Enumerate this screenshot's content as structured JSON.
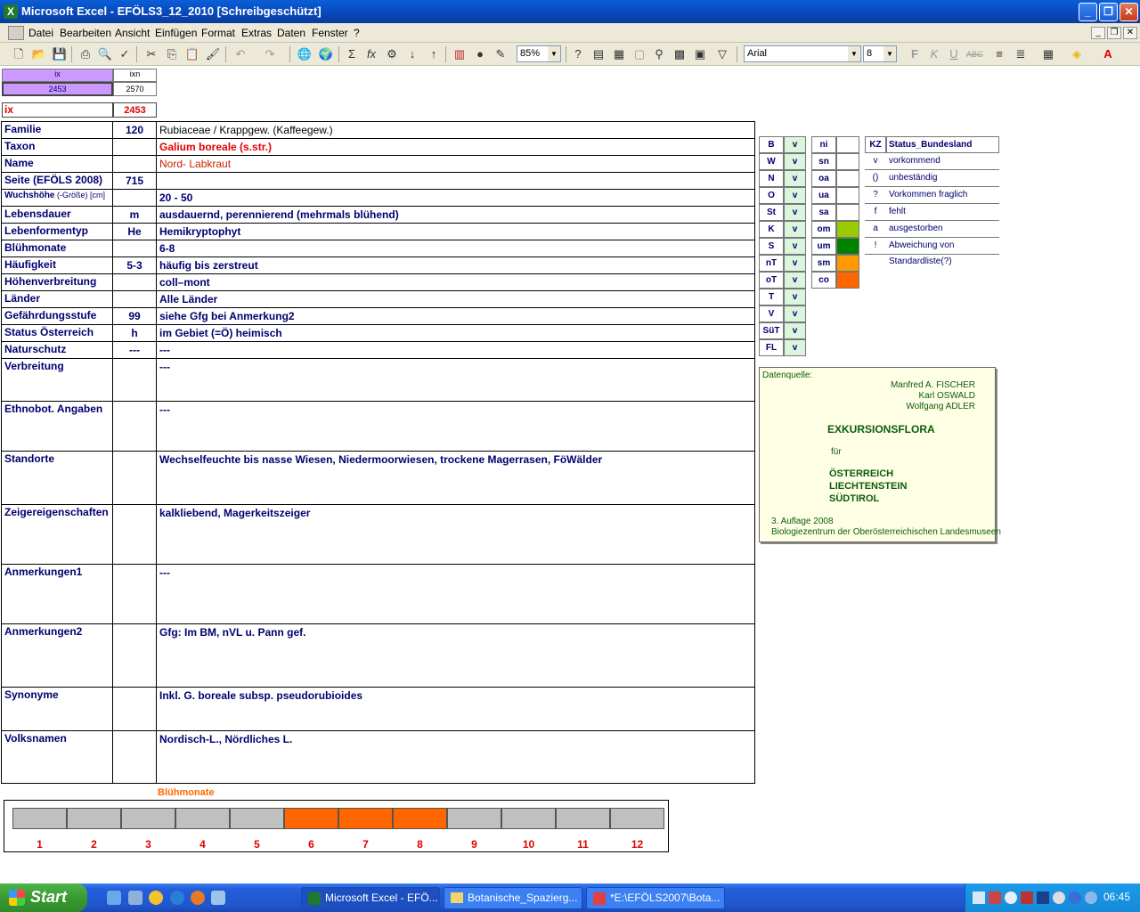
{
  "window": {
    "title": "Microsoft Excel - EFÖLS3_12_2010  [Schreibgeschützt]",
    "minimize": "_",
    "restore": "❐",
    "close": "✕"
  },
  "menu": {
    "items": [
      "Datei",
      "Bearbeiten",
      "Ansicht",
      "Einfügen",
      "Format",
      "Extras",
      "Daten",
      "Fenster",
      "?"
    ],
    "doc_controls": [
      "_",
      "❐",
      "✕"
    ]
  },
  "toolbar": {
    "zoom": "85%",
    "font": "Arial",
    "size": "8",
    "icons": [
      "new-icon",
      "open-icon",
      "save-icon",
      "print-icon",
      "preview-icon",
      "spell-icon",
      "cut-icon",
      "copy-icon",
      "paste-icon",
      "format-painter-icon",
      "undo-icon",
      "redo-icon",
      "hyperlink-icon",
      "web-icon",
      "autosum-icon",
      "function-icon",
      "sort-asc-icon",
      "sort-desc-icon",
      "chart-icon",
      "map-icon",
      "drawing-icon"
    ]
  },
  "index_box": {
    "h1": "ix",
    "h2": "ixn",
    "v1": "2453",
    "v2": "2570",
    "ix_label": "ix",
    "ix_value": "2453"
  },
  "rows": [
    {
      "label": "Familie",
      "code": "120",
      "value": "Rubiaceae  /  Krappgew. (Kaffeegew.)"
    },
    {
      "label": "Taxon",
      "code": "",
      "value": "Galium boreale (s.str.)"
    },
    {
      "label": "Name",
      "code": "",
      "value": "Nord- Labkraut"
    },
    {
      "label": "Seite (EFÖLS 2008)",
      "code": "715",
      "value": ""
    },
    {
      "label": "Wuchshöhe",
      "label_small": " (-Größe) [cm]",
      "code": "",
      "value": " 20 - 50"
    },
    {
      "label": "Lebensdauer",
      "code": "m",
      "value": "ausdauernd, perennierend (mehrmals blühend)"
    },
    {
      "label": "Lebenformentyp",
      "code": "He",
      "value": "Hemikryptophyt"
    },
    {
      "label": "Blühmonate",
      "code": "",
      "value": " 6-8"
    },
    {
      "label": "Häufigkeit",
      "code": "5-3",
      "value": "häufig bis zerstreut"
    },
    {
      "label": "Höhenverbreitung",
      "code": "",
      "value": "coll–mont"
    },
    {
      "label": "Länder",
      "code": "",
      "value": "Alle Länder"
    },
    {
      "label": "Gefährdungsstufe",
      "code": "99",
      "value": "siehe Gfg bei Anmerkung2"
    },
    {
      "label": "Status Österreich",
      "code": "h",
      "value": "im Gebiet (=Ö) heimisch"
    },
    {
      "label": "Naturschutz",
      "code": "---",
      "value": "---"
    },
    {
      "label": "Verbreitung",
      "code": "",
      "value": "---"
    },
    {
      "label": "Ethnobot. Angaben",
      "code": "",
      "value": "---"
    },
    {
      "label": "Standorte",
      "code": "",
      "value": "Wechselfeuchte bis nasse Wiesen, Niedermoorwiesen, trockene Magerrasen, FöWälder"
    },
    {
      "label": "Zeigereigenschaften",
      "code": "",
      "value": "kalkliebend, Magerkeitszeiger"
    },
    {
      "label": "Anmerkungen1",
      "code": "",
      "value": "---"
    },
    {
      "label": "Anmerkungen2",
      "code": "",
      "value": "Gfg: Im BM, nVL u. Pann gef."
    },
    {
      "label": "Synonyme",
      "code": "",
      "value": "Inkl. G. boreale subsp. pseudorubioides"
    },
    {
      "label": "Volksnamen",
      "code": "",
      "value": "Nordisch-L., Nördliches L."
    }
  ],
  "states": [
    {
      "code": "B",
      "flag": "v"
    },
    {
      "code": "W",
      "flag": "v"
    },
    {
      "code": "N",
      "flag": "v"
    },
    {
      "code": "O",
      "flag": "v"
    },
    {
      "code": "St",
      "flag": "v"
    },
    {
      "code": "K",
      "flag": "v"
    },
    {
      "code": "S",
      "flag": "v"
    },
    {
      "code": "nT",
      "flag": "v"
    },
    {
      "code": "oT",
      "flag": "v"
    },
    {
      "code": "T",
      "flag": "v"
    },
    {
      "code": "V",
      "flag": "v"
    },
    {
      "code": "SüT",
      "flag": "v"
    },
    {
      "code": "FL",
      "flag": "v"
    }
  ],
  "altitude_codes": [
    {
      "code": "ni",
      "color": "#ffffff"
    },
    {
      "code": "sn",
      "color": "#ffffff"
    },
    {
      "code": "oa",
      "color": "#ffffff"
    },
    {
      "code": "ua",
      "color": "#ffffff"
    },
    {
      "code": "sa",
      "color": "#ffffff"
    },
    {
      "code": "om",
      "color": "#99cc00"
    },
    {
      "code": "um",
      "color": "#008000"
    },
    {
      "code": "sm",
      "color": "#ff9900"
    },
    {
      "code": "co",
      "color": "#ff6600"
    }
  ],
  "legend": {
    "kz": "KZ",
    "title": "Status_Bundesland",
    "items": [
      {
        "k": "v",
        "t": "vorkommend"
      },
      {
        "k": "()",
        "t": "unbeständig"
      },
      {
        "k": "?",
        "t": "Vorkommen fraglich"
      },
      {
        "k": "f",
        "t": "fehlt"
      },
      {
        "k": "a",
        "t": "ausgestorben"
      },
      {
        "k": "!",
        "t": "Abweichung von Standardliste(?)"
      }
    ]
  },
  "datasource": {
    "label": "Datenquelle:",
    "authors": [
      "Manfred A. FISCHER",
      "Karl OSWALD",
      "Wolfgang ADLER"
    ],
    "title": "EXKURSIONSFLORA",
    "fuer": "für",
    "countries": [
      "ÖSTERREICH",
      "LIECHTENSTEIN",
      "SÜDTIROL"
    ],
    "edition": "3. Auflage 2008",
    "publisher": "Biologiezentrum der Oberösterreichischen Landesmuseen"
  },
  "chart_data": {
    "type": "bar",
    "title": "Blühmonate",
    "categories": [
      "1",
      "2",
      "3",
      "4",
      "5",
      "6",
      "7",
      "8",
      "9",
      "10",
      "11",
      "12"
    ],
    "values": [
      0,
      0,
      0,
      0,
      0,
      1,
      1,
      1,
      0,
      0,
      0,
      0
    ],
    "colors": {
      "on": "#ff6600",
      "off": "#c0c0c0"
    }
  },
  "taskbar": {
    "start": "Start",
    "tasks": [
      "Microsoft Excel - EFÖ...",
      "Botanische_Spazierg...",
      "*E:\\EFÖLS2007\\Bota..."
    ],
    "clock": "06:45"
  }
}
